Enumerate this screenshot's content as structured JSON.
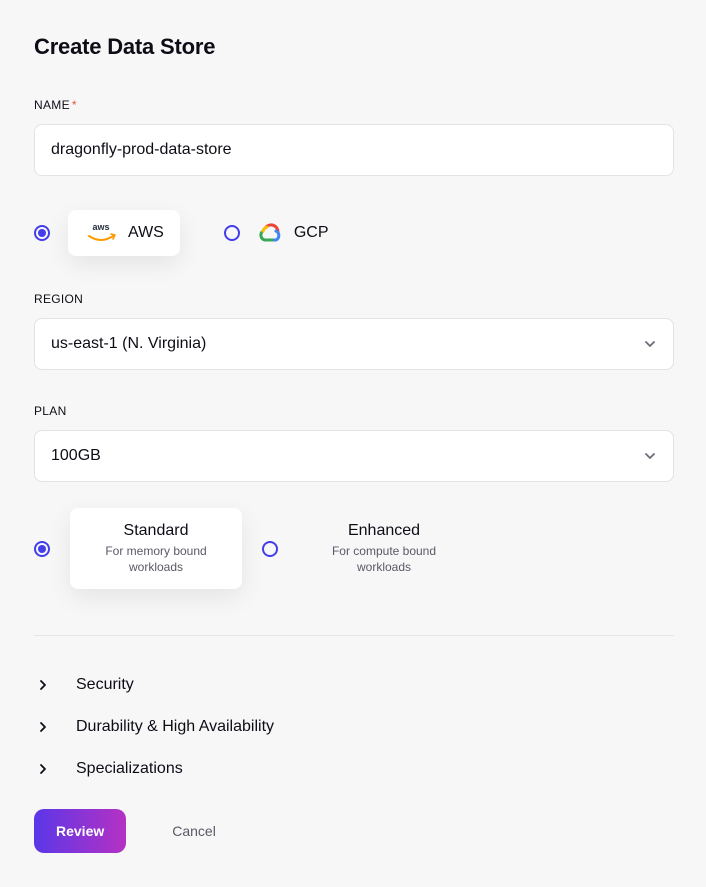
{
  "page": {
    "title": "Create Data Store"
  },
  "name_field": {
    "label": "NAME",
    "required_marker": "*",
    "value": "dragonfly-prod-data-store"
  },
  "cloud_provider": {
    "options": [
      {
        "label": "AWS",
        "selected": true,
        "icon": "aws"
      },
      {
        "label": "GCP",
        "selected": false,
        "icon": "gcp"
      }
    ]
  },
  "region_field": {
    "label": "REGION",
    "value": "us-east-1 (N. Virginia)"
  },
  "plan_field": {
    "label": "PLAN",
    "value": "100GB"
  },
  "tier": {
    "options": [
      {
        "title": "Standard",
        "subtitle": "For memory bound workloads",
        "selected": true
      },
      {
        "title": "Enhanced",
        "subtitle": "For compute bound workloads",
        "selected": false
      }
    ]
  },
  "accordion": {
    "items": [
      {
        "label": "Security"
      },
      {
        "label": "Durability & High Availability"
      },
      {
        "label": "Specializations"
      }
    ]
  },
  "footer": {
    "primary": "Review",
    "cancel": "Cancel"
  }
}
